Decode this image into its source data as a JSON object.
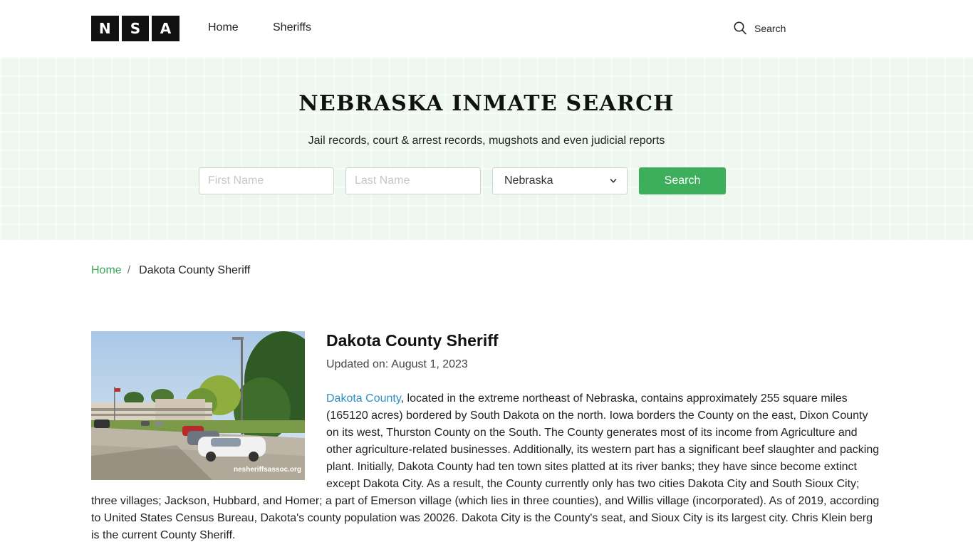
{
  "header": {
    "logo_letters": [
      "N",
      "S",
      "A"
    ],
    "nav": [
      {
        "label": "Home"
      },
      {
        "label": "Sheriffs"
      }
    ],
    "search_label": "Search",
    "search_icon": "search-icon"
  },
  "hero": {
    "title": "NEBRASKA INMATE SEARCH",
    "subtitle": "Jail records, court & arrest records, mugshots and even judicial reports",
    "first_name_placeholder": "First Name",
    "last_name_placeholder": "Last Name",
    "state_selected": "Nebraska",
    "search_button": "Search",
    "accent_color": "#3cae5c"
  },
  "breadcrumb": {
    "home": "Home",
    "separator": "/",
    "current": "Dakota County Sheriff"
  },
  "article": {
    "title": "Dakota County Sheriff",
    "updated_label": "Updated on:",
    "updated_date": "August 1, 2023",
    "image_watermark": "nesheriffsassoc.org",
    "link_text": "Dakota County",
    "body": ", located in the extreme northeast of Nebraska, contains approximately 255 square miles (165120 acres) bordered by South Dakota on the north. Iowa borders the County on the east, Dixon County on its west, Thurston County on the South. The County generates most of its income from Agriculture and other agriculture-related businesses. Additionally, its western part has a significant beef slaughter and packing plant. Initially, Dakota County had ten town sites platted at its river banks; they have since become extinct except Dakota City. As a result, the County currently only has two cities Dakota City and South Sioux City; three villages; Jackson, Hubbard, and Homer; a part of Emerson village (which lies in three counties), and Willis village (incorporated). As of 2019, according to United States Census Bureau, Dakota's county population was 20026. Dakota City is the County's seat, and Sioux City is its largest city. Chris Klein berg is the current County Sheriff."
  }
}
